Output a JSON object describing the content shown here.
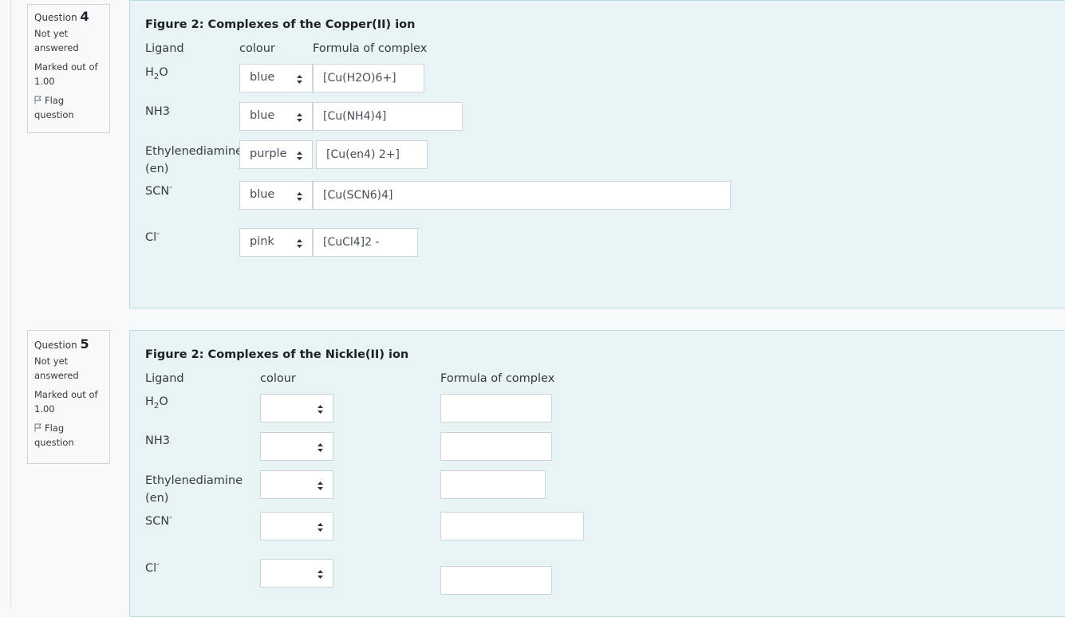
{
  "questions": [
    {
      "info": {
        "question_label": "Question",
        "number": "4",
        "state_line1": "Not yet",
        "state_line2": "answered",
        "grade_line1": "Marked out of",
        "grade_line2": "1.00",
        "flag_line1": "Flag",
        "flag_line2": "question"
      },
      "title": "Figure 2: Complexes of the Copper(II) ion",
      "headers": {
        "ligand": "Ligand",
        "colour": "colour",
        "formula": "Formula of complex"
      },
      "rows": [
        {
          "ligand_main": "H",
          "ligand_sub": "2",
          "ligand_tail": "O",
          "ligand_sup": "",
          "colour": "blue",
          "formula": "[Cu(H2O)6+]"
        },
        {
          "ligand_main": "NH",
          "ligand_sub": "3",
          "ligand_tail": "",
          "ligand_sup": "",
          "colour": "blue",
          "formula": "[Cu(NH4)4]"
        },
        {
          "ligand_main": "Ethylenediamine",
          "ligand_line2": "(en)",
          "colour": "purple",
          "formula": "[Cu(en4) 2+]"
        },
        {
          "ligand_main": "SCN",
          "ligand_sup": "-",
          "colour": "blue",
          "formula": "[Cu(SCN6)4]"
        },
        {
          "ligand_main": "Cl",
          "ligand_sup": "-",
          "colour": "pink",
          "formula": "[CuCl4]2 -"
        }
      ]
    },
    {
      "info": {
        "question_label": "Question",
        "number": "5",
        "state_line1": "Not yet",
        "state_line2": "answered",
        "grade_line1": "Marked out of",
        "grade_line2": "1.00",
        "flag_line1": "Flag",
        "flag_line2": "question"
      },
      "title": "Figure 2: Complexes of the Nickle(II) ion",
      "headers": {
        "ligand": "Ligand",
        "colour": "colour",
        "formula": "Formula of complex"
      },
      "rows": [
        {
          "ligand_main": "H",
          "ligand_sub": "2",
          "ligand_tail": "O",
          "colour": "",
          "formula": ""
        },
        {
          "ligand_main": "NH",
          "ligand_sub": "3",
          "colour": "",
          "formula": ""
        },
        {
          "ligand_main": "Ethylenediamine",
          "ligand_line2": "(en)",
          "colour": "",
          "formula": ""
        },
        {
          "ligand_main": "SCN",
          "ligand_sup": "-",
          "colour": "",
          "formula": ""
        },
        {
          "ligand_main": "Cl",
          "ligand_sup": "-",
          "colour": "",
          "formula": ""
        }
      ]
    }
  ],
  "icons": {
    "flag": "flag-icon",
    "select_arrow": "updown-caret-icon"
  }
}
